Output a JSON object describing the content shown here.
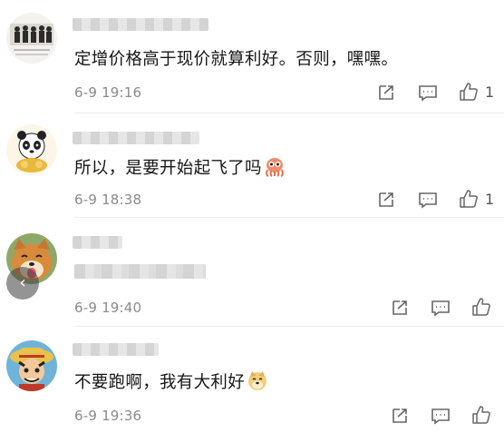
{
  "comments": [
    {
      "avatar": "group-photo-avatar",
      "text": "定增价格高于现价就算利好。否则，嘿嘿。",
      "emoji": "",
      "time": "6-9 19:16",
      "likes": "1"
    },
    {
      "avatar": "panda-avatar",
      "text": "所以，是要开始起飞了吗",
      "emoji": "octopus-emoji",
      "time": "6-9 18:38",
      "likes": "1"
    },
    {
      "avatar": "shiba-dog-avatar",
      "text": "",
      "emoji": "",
      "time": "6-9 19:40",
      "likes": ""
    },
    {
      "avatar": "cartoon-pirate-avatar",
      "text": "不要跑啊，我有大利好",
      "emoji": "doge-emoji",
      "time": "6-9 19:36",
      "likes": ""
    }
  ],
  "icons": {
    "share": "share-icon",
    "comment": "comment-icon",
    "like": "thumbs-up-icon",
    "back": "chevron-left-icon"
  },
  "colors": {
    "text": "#161616",
    "time": "#8a8a8a",
    "divider": "#ececec"
  }
}
